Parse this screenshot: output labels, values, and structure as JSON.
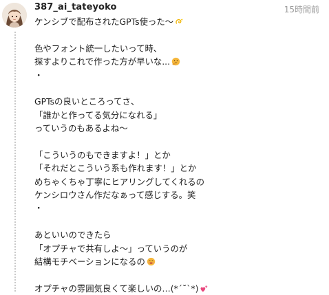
{
  "post": {
    "username": "387_ai_tateyoko",
    "timestamp": "15時間前",
    "lines": [
      {
        "text": "ケンシブで配布されたGPTs使った〜",
        "emoji": "dizzy-emoji"
      },
      {
        "text": "",
        "emoji": ""
      },
      {
        "text": "色やフォント統一したいって時、",
        "emoji": ""
      },
      {
        "text": "探すよりこれで作った方が早いな...",
        "emoji": "thinking-emoji"
      },
      {
        "text": "・",
        "emoji": ""
      },
      {
        "text": "",
        "emoji": ""
      },
      {
        "text": "GPTsの良いところってさ、",
        "emoji": ""
      },
      {
        "text": "「誰かと作ってる気分になれる」",
        "emoji": ""
      },
      {
        "text": "っていうのもあるよね〜",
        "emoji": ""
      },
      {
        "text": "",
        "emoji": ""
      },
      {
        "text": "「こういうのもできますよ！」とか",
        "emoji": ""
      },
      {
        "text": "「それだとこういう系も作れます！」とか",
        "emoji": ""
      },
      {
        "text": "めちゃくちゃ丁寧にヒアリングしてくれるの",
        "emoji": ""
      },
      {
        "text": "ケンシロウさん作だなぁって感じする。笑",
        "emoji": ""
      },
      {
        "text": "・",
        "emoji": ""
      },
      {
        "text": "",
        "emoji": ""
      },
      {
        "text": "あといいのできたら",
        "emoji": ""
      },
      {
        "text": "「オプチャで共有しよ〜」っていうのが",
        "emoji": ""
      },
      {
        "text": "結構モチベーションになるの",
        "emoji": "grin-emoji"
      },
      {
        "text": "",
        "emoji": ""
      },
      {
        "text": "オプチャの雰囲気良くて楽しいの…(*´˘`*)",
        "emoji": "hearts-emoji"
      }
    ]
  },
  "colors": {
    "username": "#222222",
    "timestamp": "#9a9a9a",
    "thread_line": "#c9c9c9"
  }
}
